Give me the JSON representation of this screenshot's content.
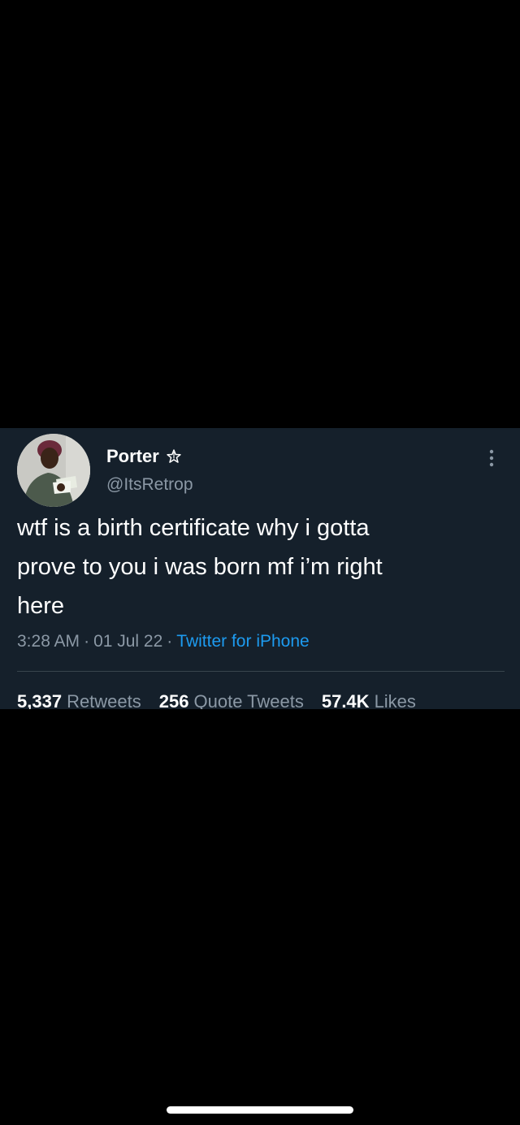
{
  "tweet": {
    "author": {
      "display_name": "Porter",
      "badge_icon": "star-outline-icon",
      "handle": "@ItsRetrop"
    },
    "text": "wtf is a birth certificate why i gotta\nprove to you i was born mf i’m right\nhere",
    "time": "3:28 AM",
    "date": "01 Jul 22",
    "separator": "·",
    "source": "Twitter for iPhone",
    "stats": {
      "retweets": {
        "count": "5,337",
        "label": "Retweets"
      },
      "quote_tweets": {
        "count": "256",
        "label": "Quote Tweets"
      },
      "likes": {
        "count": "57.4K",
        "label": "Likes"
      }
    }
  },
  "colors": {
    "background": "#000000",
    "card": "#15202b",
    "text": "#ffffff",
    "muted": "#8b98a5",
    "link": "#1d9bf0",
    "divider": "#38444d"
  }
}
